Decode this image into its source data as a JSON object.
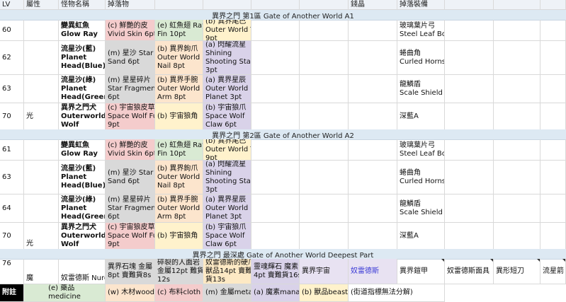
{
  "headers": {
    "lv": "LV",
    "attr": "屬性",
    "monster": "怪物名稱",
    "drops": "掉落物",
    "crystal": "錢晶",
    "equip": "掉落裝備"
  },
  "sections": [
    {
      "title": "異界之門 第1區 Gate of Another World A1",
      "rows": [
        {
          "lv": "60",
          "attr": "",
          "monster": [
            "變異虹魚",
            "Glow Ray"
          ],
          "d1": [
            "(c) 鮮艷的皮",
            "Vivid Skin 6pt"
          ],
          "d2": [
            "(e) 虹魚翅 Ray",
            "Fin 10pt"
          ],
          "d3": [
            "(b) 異界尾巴",
            "Outer World Tail",
            "9pt"
          ],
          "equip": [
            "玻璃葉片弓",
            "Steel Leaf Bow"
          ]
        },
        {
          "lv": "62",
          "attr": "",
          "monster": [
            "流星沙(藍)",
            "Planet",
            "Head(Blue)"
          ],
          "d1": [
            "(m) 星沙 Star",
            "Sand 6pt"
          ],
          "d2": [
            "(b) 異界鉤爪",
            "Outer World",
            "Nail 8pt"
          ],
          "d3": [
            "(a) 閃耀流星",
            "Shining",
            "Shooting Star",
            "3pt"
          ],
          "equip": [
            "蜷曲角",
            "Curled Horns"
          ]
        },
        {
          "lv": "63",
          "attr": "",
          "monster": [
            "流星沙(綠)",
            "Planet",
            "Head(Green)"
          ],
          "d1": [
            "(m) 星星碎片",
            "Star Fragment",
            "6pt"
          ],
          "d2": [
            "(b) 異界手腕",
            "Outer World",
            "Arm 8pt"
          ],
          "d3": [
            "(a) 異界星辰",
            "Outer World",
            "Planet 3pt"
          ],
          "equip": [
            "龍鱗盾",
            "Scale Shield"
          ]
        },
        {
          "lv": "70",
          "attr": "光",
          "monster": [
            "異界之門犬",
            "Outerworld",
            "Wolf"
          ],
          "d1": [
            "(c) 宇宙狼皮草",
            "Space Wolf Fur",
            "9pt"
          ],
          "d2": [
            "(b) 宇宙狼角",
            ""
          ],
          "d3": [
            "(b) 宇宙狼爪",
            "Space Wolf",
            "Claw 6pt"
          ],
          "equip": [
            "深藍A"
          ]
        }
      ]
    },
    {
      "title": "異界之門 第2區 Gate of Another World A2",
      "rows": [
        {
          "lv": "61",
          "attr": "",
          "monster": [
            "變異虹魚",
            "Glow Ray"
          ],
          "d1": [
            "(c) 鮮艷的皮",
            "Vivid Skin 6pt"
          ],
          "d2": [
            "(e) 虹魚翅 Ray",
            "Fin 10pt"
          ],
          "d3": [
            "(b) 異界尾巴",
            "Outer World Tail",
            "9pt"
          ],
          "equip": [
            "玻璃葉片弓",
            "Steel Leaf Bow"
          ]
        },
        {
          "lv": "63",
          "attr": "",
          "monster": [
            "流星沙(藍)",
            "Planet",
            "Head(Blue)"
          ],
          "d1": [
            "(m) 星沙 Star",
            "Sand 6pt"
          ],
          "d2": [
            "(b) 異界鉤爪",
            "Outer World",
            "Nail 8pt"
          ],
          "d3": [
            "(a) 閃耀流星",
            "Shining",
            "Shooting Star",
            "3pt"
          ],
          "equip": [
            "蜷曲角",
            "Curled Horns"
          ]
        },
        {
          "lv": "64",
          "attr": "",
          "monster": [
            "流星沙(綠)",
            "Planet",
            "Head(Green)"
          ],
          "d1": [
            "(m) 星星碎片",
            "Star Fragment",
            "6pt"
          ],
          "d2": [
            "(b) 異界手腕",
            "Outer World",
            "Arm 8pt"
          ],
          "d3": [
            "(a) 異界星辰",
            "Outer World",
            "Planet 3pt"
          ],
          "equip": [
            "龍鱗盾",
            "Scale Shield"
          ]
        },
        {
          "lv": "70",
          "attr": "光",
          "monster": [
            "異界之門犬",
            "Outerworld",
            "Wolf"
          ],
          "d1": [
            "(c) 宇宙狼皮草",
            "Space Wolf Fur",
            "9pt"
          ],
          "d2": [
            "(b) 宇宙狼角",
            ""
          ],
          "d3": [
            "(b) 宇宙狼爪",
            "Space Wolf",
            "Claw 6pt"
          ],
          "equip": [
            "深藍A"
          ]
        }
      ]
    },
    {
      "title": "異界之門 最深處 Gate of Another World Deepest Part",
      "deep": {
        "lv": "76",
        "attr": "魔",
        "monster": "奴雷德斯 Nureth",
        "d1": [
          "異界石塊 金屬",
          "8pt 賣難貨8s"
        ],
        "d2": [
          "碎裂的人面岩",
          "金屬12pt 難貨",
          "12s"
        ],
        "d3": [
          "奴雷德斯的硬爪",
          "獸品14pt 賣難",
          "貨13s"
        ],
        "d4": [
          "靈魂輝石 魔素",
          "4pt 賣難貨16s"
        ],
        "d5": [
          "異界宇宙"
        ],
        "crystal": "奴雷德斯",
        "equip1": "異界鎧甲",
        "equip2": "奴雷德斯面具",
        "equip3": "異形短刀",
        "equip4": "流星箭"
      }
    }
  ],
  "footer": {
    "label": "附註",
    "items": [
      [
        "(e) 藥品",
        "medicine"
      ],
      [
        "(w) 木材wood"
      ],
      [
        "(c) 布料cloth"
      ],
      [
        "(m) 金屬metal"
      ],
      [
        "(a) 魔素mana"
      ],
      [
        "(b) 獸品beast"
      ],
      [
        "(街道指標無法分解)"
      ]
    ]
  }
}
